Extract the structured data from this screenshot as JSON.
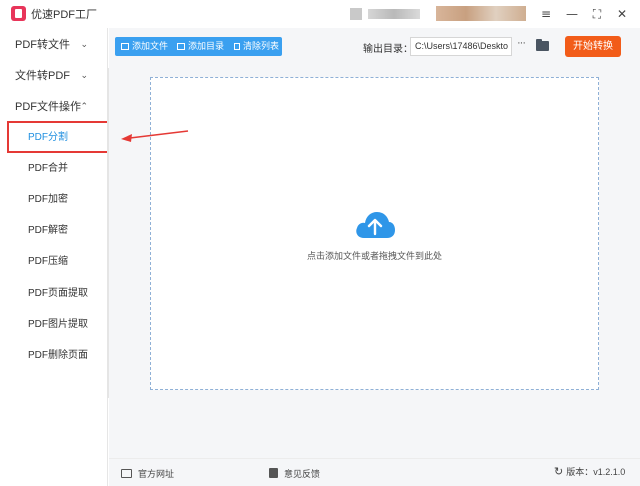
{
  "window": {
    "title": "优速PDF工厂",
    "controls": [
      "≡",
      "—",
      "⛶",
      "✕"
    ]
  },
  "sidebar": {
    "groups": [
      {
        "label": "PDF转文件",
        "chevron": "⌄"
      },
      {
        "label": "文件转PDF",
        "chevron": "⌄"
      },
      {
        "label": "PDF文件操作",
        "chevron": "⌃"
      }
    ],
    "items": [
      {
        "label": "PDF分割",
        "active": true
      },
      {
        "label": "PDF合并"
      },
      {
        "label": "PDF加密"
      },
      {
        "label": "PDF解密"
      },
      {
        "label": "PDF压缩"
      },
      {
        "label": "PDF页面提取"
      },
      {
        "label": "PDF图片提取"
      },
      {
        "label": "PDF删除页面"
      }
    ]
  },
  "toolbar": {
    "add_file": "添加文件",
    "add_folder": "添加目录",
    "clear_list": "清除列表",
    "output_label": "输出目录：",
    "output_path": "C:\\Users\\17486\\Deskto",
    "more": "···",
    "start_label": "开始转换"
  },
  "dropzone": {
    "hint": "点击添加文件或者拖拽文件到此处",
    "icon": "cloud-upload-icon"
  },
  "statusbar": {
    "website": "官方网址",
    "feedback": "意见反馈",
    "version": "版本：v1.2.1.0"
  },
  "colors": {
    "accent": "#3aa0f0",
    "start_button": "#f25c19",
    "highlight_box": "#e53935",
    "active_item": "#1f8fe0"
  }
}
